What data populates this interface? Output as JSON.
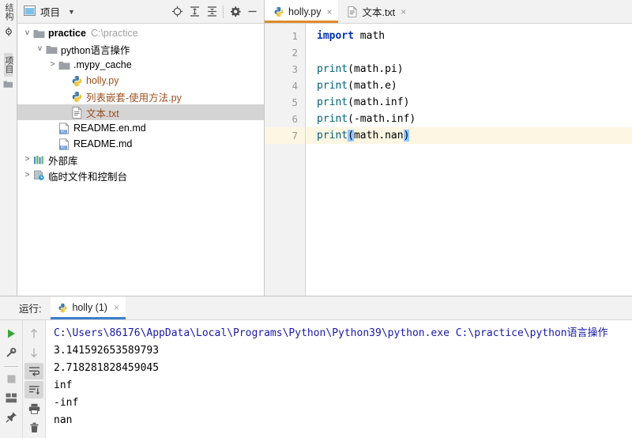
{
  "tool_strip": {
    "tabs": [
      {
        "name": "structure",
        "label": "结构"
      },
      {
        "name": "project",
        "label": "项目"
      }
    ],
    "icons": [
      "bookmark-icon",
      "folder-icon"
    ]
  },
  "project_pane": {
    "header": {
      "title": "项目",
      "dropdown_caret": "▼",
      "buttons": [
        {
          "name": "locate-icon",
          "title": "选择打开的文件"
        },
        {
          "name": "expand-all-icon",
          "title": "全部展开"
        },
        {
          "name": "collapse-all-icon",
          "title": "全部折叠"
        },
        {
          "name": "settings-gear-icon",
          "title": "设置"
        },
        {
          "name": "hide-icon",
          "title": "隐藏"
        }
      ]
    },
    "tree": [
      {
        "indent": 0,
        "twist": "v",
        "icon": "folder-icon",
        "label": "practice",
        "bold": true,
        "sub": "C:\\practice",
        "selected": false
      },
      {
        "indent": 1,
        "twist": "v",
        "icon": "folder-icon",
        "label": "python语言操作",
        "bold": false,
        "sub": "",
        "selected": false
      },
      {
        "indent": 2,
        "twist": ">",
        "icon": "folder-icon",
        "label": ".mypy_cache",
        "bold": false,
        "sub": "",
        "selected": false
      },
      {
        "indent": 3,
        "twist": "",
        "icon": "python-file-icon",
        "label": "holly.py",
        "bold": false,
        "sub": "",
        "selected": false,
        "orange": true
      },
      {
        "indent": 3,
        "twist": "",
        "icon": "python-file-icon",
        "label": "列表嵌套-使用方法.py",
        "bold": false,
        "sub": "",
        "selected": false,
        "orange": true
      },
      {
        "indent": 3,
        "twist": "",
        "icon": "text-file-icon",
        "label": "文本.txt",
        "bold": false,
        "sub": "",
        "selected": true,
        "orange": true
      },
      {
        "indent": 2,
        "twist": "",
        "icon": "markdown-file-icon",
        "label": "README.en.md",
        "bold": false,
        "sub": "",
        "selected": false
      },
      {
        "indent": 2,
        "twist": "",
        "icon": "markdown-file-icon",
        "label": "README.md",
        "bold": false,
        "sub": "",
        "selected": false
      },
      {
        "indent": 0,
        "twist": ">",
        "icon": "library-icon",
        "label": "外部库",
        "bold": false,
        "sub": "",
        "selected": false
      },
      {
        "indent": 0,
        "twist": ">",
        "icon": "scratches-icon",
        "label": "临时文件和控制台",
        "bold": false,
        "sub": "",
        "selected": false
      }
    ]
  },
  "editor": {
    "tabs": [
      {
        "label": "holly.py",
        "icon": "python-file-icon",
        "active": true,
        "close": "×"
      },
      {
        "label": "文本.txt",
        "icon": "text-file-icon",
        "active": false,
        "close": "×"
      }
    ],
    "line_numbers": [
      "1",
      "2",
      "3",
      "4",
      "5",
      "6",
      "7"
    ],
    "caret_line": 7,
    "lines": [
      {
        "n": 1,
        "tokens": [
          {
            "t": "import",
            "c": "kw"
          },
          {
            "t": " math",
            "c": "ident"
          }
        ]
      },
      {
        "n": 2,
        "tokens": [
          {
            "t": "",
            "c": "ident"
          }
        ]
      },
      {
        "n": 3,
        "tokens": [
          {
            "t": "print",
            "c": "fn"
          },
          {
            "t": "(math.pi)",
            "c": "punct"
          }
        ]
      },
      {
        "n": 4,
        "tokens": [
          {
            "t": "print",
            "c": "fn"
          },
          {
            "t": "(math.e)",
            "c": "punct"
          }
        ]
      },
      {
        "n": 5,
        "tokens": [
          {
            "t": "print",
            "c": "fn"
          },
          {
            "t": "(math.inf)",
            "c": "punct"
          }
        ]
      },
      {
        "n": 6,
        "tokens": [
          {
            "t": "print",
            "c": "fn"
          },
          {
            "t": "(-math.inf)",
            "c": "punct"
          }
        ]
      },
      {
        "n": 7,
        "tokens": [
          {
            "t": "print",
            "c": "fn"
          },
          {
            "t": "(",
            "c": "paren-match"
          },
          {
            "t": "math.nan",
            "c": "punct"
          },
          {
            "t": ")",
            "c": "paren-match"
          }
        ]
      }
    ],
    "plain_code": [
      "import math",
      "",
      "print(math.pi)",
      "print(math.e)",
      "print(math.inf)",
      "print(-math.inf)",
      "print(math.nan)"
    ]
  },
  "run_window": {
    "label": "运行:",
    "tab": {
      "label": "holly (1)",
      "icon": "python-file-icon",
      "close": "×"
    },
    "left_tools": [
      {
        "name": "rerun-button",
        "icon": "play-icon",
        "toggled": false
      },
      {
        "name": "debug-settings-button",
        "icon": "wrench-icon",
        "toggled": false
      },
      {
        "name": "stop-button",
        "icon": "stop-square-icon",
        "toggled": false
      },
      {
        "name": "layout-button",
        "icon": "layout-icon",
        "toggled": false
      },
      {
        "name": "pin-tab-button",
        "icon": "pin-icon",
        "toggled": false
      }
    ],
    "right_tools": [
      {
        "name": "up-the-stack-button",
        "icon": "arrow-up-icon",
        "toggled": false
      },
      {
        "name": "down-the-stack-button",
        "icon": "arrow-down-icon",
        "toggled": false
      },
      {
        "name": "soft-wrap-button",
        "icon": "soft-wrap-icon",
        "toggled": true
      },
      {
        "name": "scroll-to-end-button",
        "icon": "scroll-to-end-icon",
        "toggled": true
      },
      {
        "name": "print-button",
        "icon": "printer-icon",
        "toggled": false
      },
      {
        "name": "clear-all-button",
        "icon": "trash-icon",
        "toggled": false
      }
    ],
    "console_lines": [
      {
        "text": "C:\\Users\\86176\\AppData\\Local\\Programs\\Python\\Python39\\python.exe C:\\practice\\python语言操作",
        "kind": "cmd"
      },
      {
        "text": "3.141592653589793",
        "kind": "out"
      },
      {
        "text": "2.718281828459045",
        "kind": "out"
      },
      {
        "text": "inf",
        "kind": "out"
      },
      {
        "text": "-inf",
        "kind": "out"
      },
      {
        "text": "nan",
        "kind": "out"
      }
    ]
  },
  "colors": {
    "accent_tab": "#e08b28",
    "run_tab": "#3d7fcc",
    "caret_line": "#fdf6e3",
    "keyword": "#0033b3",
    "function": "#00627a",
    "console_cmd": "#1a1aa6",
    "selection": "#d4d4d4"
  }
}
